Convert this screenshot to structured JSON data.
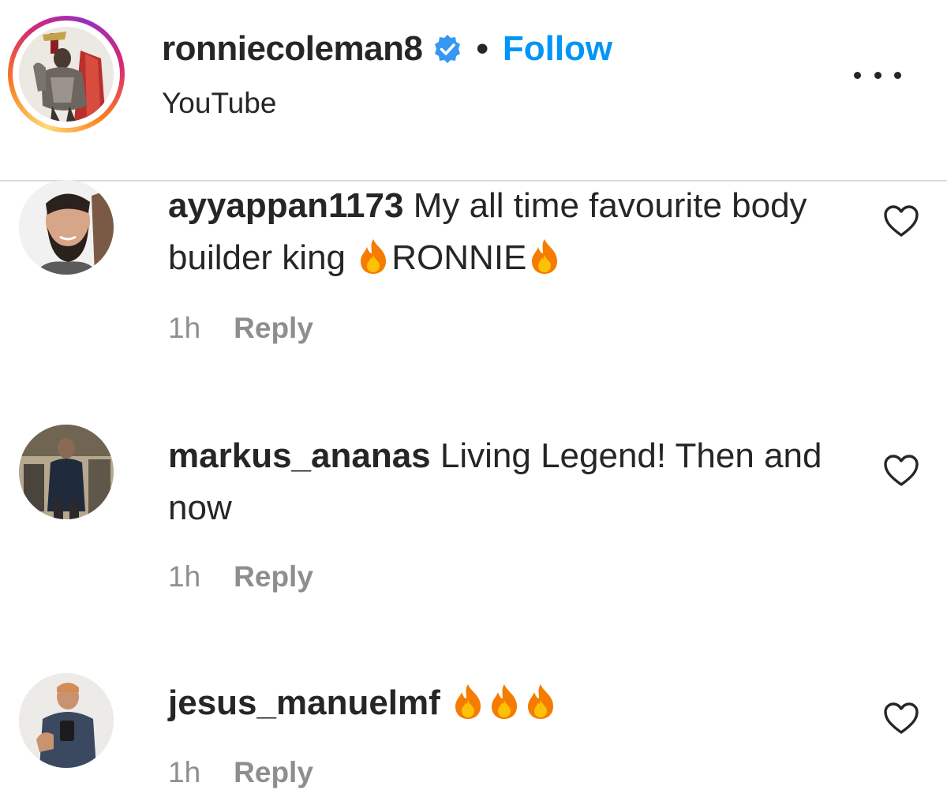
{
  "post_header": {
    "username": "ronniecoleman8",
    "verified_icon": "verified-badge-icon",
    "separator": "•",
    "follow_label": "Follow",
    "subtitle": "YouTube",
    "more_icon": "more-options-icon"
  },
  "colors": {
    "link_blue": "#0095f6",
    "text_primary": "#262626",
    "text_secondary": "#8e8e8e",
    "divider": "#dbdbdb",
    "verified_blue": "#3897f0"
  },
  "comments": [
    {
      "username": "ayyappan1173",
      "text_parts": [
        "My all time favourite body builder king ",
        "RONNIE",
        ""
      ],
      "emoji": "fire",
      "time": "1h",
      "reply_label": "Reply",
      "like_icon": "heart-icon"
    },
    {
      "username": "markus_ananas",
      "text": "Living Legend! Then and now",
      "time": "1h",
      "reply_label": "Reply",
      "like_icon": "heart-icon"
    },
    {
      "username": "jesus_manuelmf",
      "text": "",
      "emoji_count": 3,
      "emoji": "fire",
      "time": "1h",
      "reply_label": "Reply",
      "like_icon": "heart-icon"
    }
  ]
}
